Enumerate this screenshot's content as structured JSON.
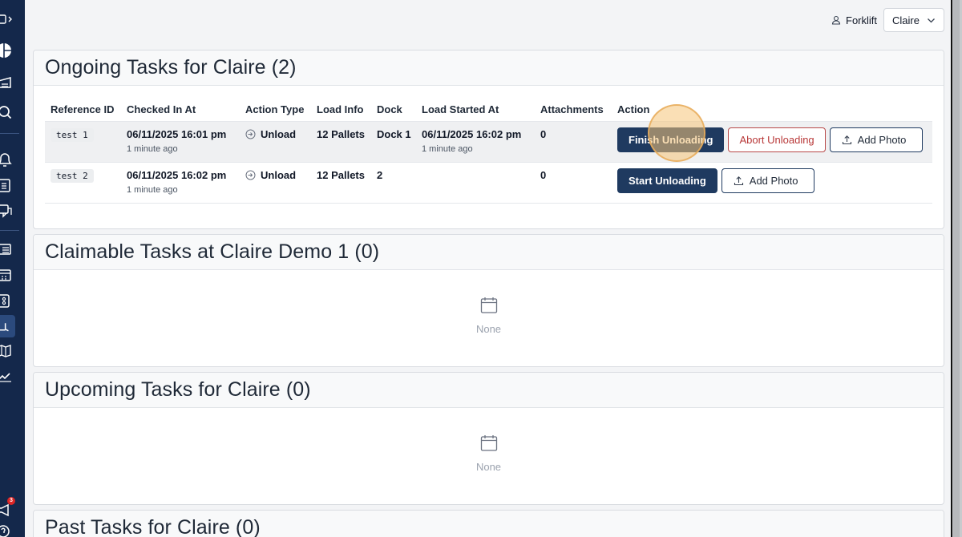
{
  "topbar": {
    "role": "Forklift",
    "user": "Claire"
  },
  "ongoing": {
    "title": "Ongoing Tasks for Claire (2)",
    "columns": [
      "Reference ID",
      "Checked In At",
      "Action Type",
      "Load Info",
      "Dock",
      "Load Started At",
      "Attachments",
      "Action"
    ],
    "rows": [
      {
        "ref": "test 1",
        "checked_in": "06/11/2025 16:01 pm",
        "checked_in_ago": "1 minute ago",
        "action_type": "Unload",
        "load_info": "12 Pallets",
        "dock": "Dock 1",
        "load_started": "06/11/2025 16:02 pm",
        "load_started_ago": "1 minute ago",
        "attachments": "0",
        "buttons": {
          "primary": "Finish Unloading",
          "danger": "Abort Unloading",
          "photo": "Add Photo"
        }
      },
      {
        "ref": "test 2",
        "checked_in": "06/11/2025 16:02 pm",
        "checked_in_ago": "1 minute ago",
        "action_type": "Unload",
        "load_info": "12 Pallets",
        "dock": "2",
        "load_started": "",
        "load_started_ago": "",
        "attachments": "0",
        "buttons": {
          "primary": "Start Unloading",
          "photo": "Add Photo"
        }
      }
    ]
  },
  "claimable": {
    "title": "Claimable Tasks at Claire Demo 1 (0)",
    "empty": "None"
  },
  "upcoming": {
    "title": "Upcoming Tasks for Claire (0)",
    "empty": "None"
  },
  "past": {
    "title": "Past Tasks for Claire (0)"
  },
  "sidebar": {
    "notification_count": "3"
  },
  "colors": {
    "sidebar": "#14284b",
    "primary": "#1f3a60",
    "danger": "#b83838",
    "highlight": "#f6c478"
  }
}
